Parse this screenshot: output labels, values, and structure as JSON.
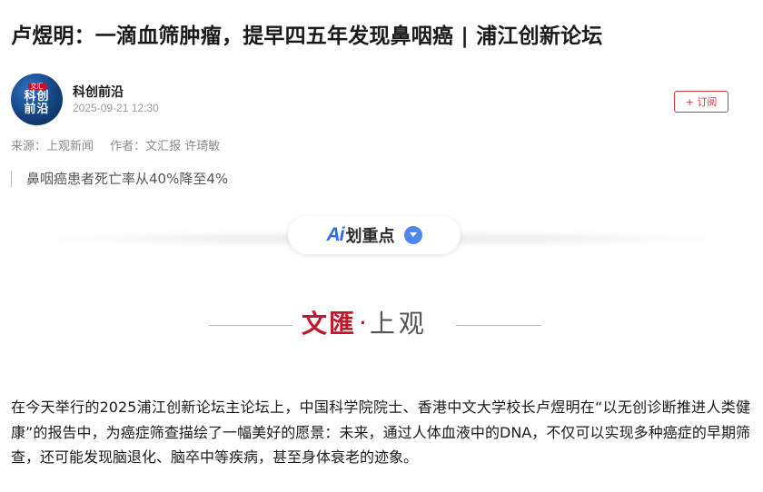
{
  "article": {
    "title": "卢煜明：一滴血筛肿瘤，提早四五年发现鼻咽癌 | 浦江创新论坛",
    "author": {
      "name": "科创前沿",
      "avatar_text_top": "文汇",
      "avatar_text_line1": "科创",
      "avatar_text_line2": "前沿",
      "datetime": "2025-09-21 12:30"
    },
    "subscribe_label": "+ 订阅",
    "source_label": "来源：上观新闻",
    "writer_label": "作者：文汇报 许琦敏",
    "summary": "鼻咽癌患者死亡率从40%降至4%",
    "highlights": {
      "ai_label": "Ai",
      "label": "划重点"
    },
    "brand": {
      "red_text": "文匯",
      "separator": "·",
      "grey_text": "上观"
    },
    "paragraph": "在今天举行的2025浦江创新论坛主论坛上，中国科学院院士、香港中文大学校长卢煜明在“以无创诊断推进人类健康”的报告中，为癌症筛查描绘了一幅美好的愿景：未来，通过人体血液中的DNA，不仅可以实现多种癌症的早期筛查，还可能发现脑退化、脑卒中等疾病，甚至身体衰老的迹象。"
  },
  "colors": {
    "accent_red": "#d9363e",
    "brand_red": "#c3162b",
    "ai_blue": "#2f6fe0"
  },
  "icons": {
    "highlights_toggle": "chevron-down-icon"
  }
}
